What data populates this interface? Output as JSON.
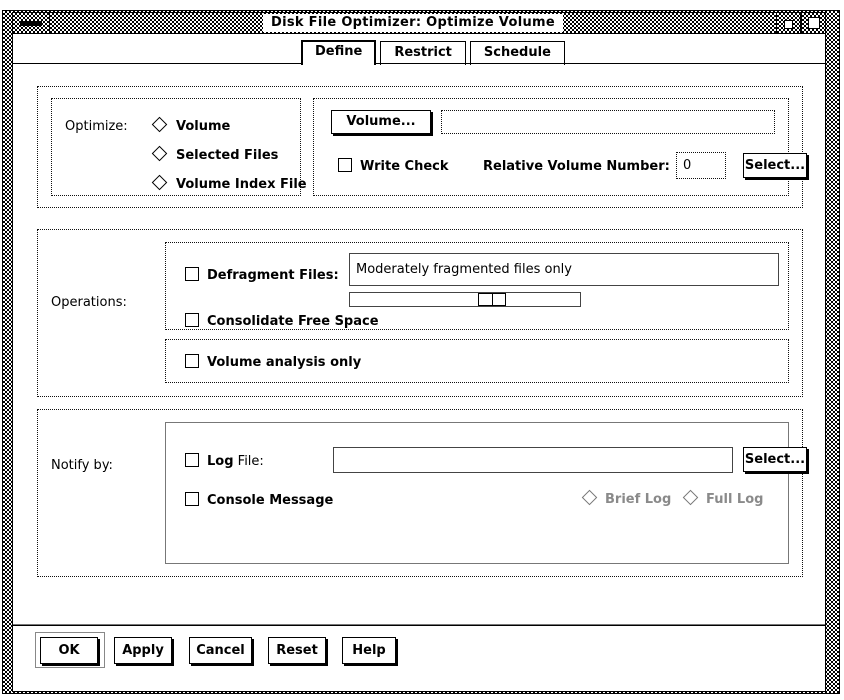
{
  "window": {
    "title": "Disk File Optimizer: Optimize Volume",
    "menu_button": "window-menu",
    "minimize_button": "minimize",
    "maximize_button": "maximize"
  },
  "tabs": [
    {
      "label": "Define",
      "active": true
    },
    {
      "label": "Restrict",
      "active": false
    },
    {
      "label": "Schedule",
      "active": false
    }
  ],
  "optimize": {
    "group_label": "Optimize:",
    "radios": [
      {
        "label": "Volume",
        "selected": false
      },
      {
        "label": "Selected Files",
        "selected": false
      },
      {
        "label": "Volume Index File",
        "selected": false
      }
    ],
    "volume_button": "Volume...",
    "volume_field_value": "",
    "volume_field_placeholder": "",
    "write_check": {
      "label": "Write Check",
      "checked": false
    },
    "relative_volume_number_label": "Relative Volume Number:",
    "relative_volume_number_value": "0",
    "select_button": "Select..."
  },
  "operations": {
    "group_label": "Operations:",
    "defragment": {
      "label": "Defragment Files:",
      "checked": false
    },
    "defragment_level_text": "Moderately fragmented files only",
    "defragment_slider": {
      "value": 45,
      "min": 0,
      "max": 100
    },
    "consolidate": {
      "label": "Consolidate Free Space",
      "checked": false
    },
    "analysis_only": {
      "label": "Volume analysis only",
      "checked": false
    }
  },
  "notify": {
    "group_label": "Notify by:",
    "log_file": {
      "label_bold": "Log",
      "label_rest": " File:",
      "checked": false
    },
    "log_file_field_value": "",
    "select_button": "Select...",
    "console_message": {
      "label": "Console Message",
      "checked": false
    },
    "log_detail_radios": [
      {
        "label": "Brief Log",
        "selected": false,
        "disabled": true
      },
      {
        "label": "Full Log",
        "selected": false,
        "disabled": true
      }
    ]
  },
  "actions": [
    {
      "label": "OK",
      "is_default": true
    },
    {
      "label": "Apply",
      "is_default": false
    },
    {
      "label": "Cancel",
      "is_default": false
    },
    {
      "label": "Reset",
      "is_default": false
    },
    {
      "label": "Help",
      "is_default": false
    }
  ]
}
